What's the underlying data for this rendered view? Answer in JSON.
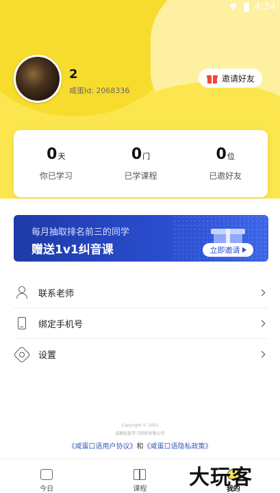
{
  "status": {
    "time": "4:34"
  },
  "profile": {
    "name": "2",
    "user_id": "咸蛋Id: 2068336",
    "invite_button": "邀请好友"
  },
  "stats": [
    {
      "value": "0",
      "unit": "天",
      "label": "你已学习"
    },
    {
      "value": "0",
      "unit": "门",
      "label": "已学课程"
    },
    {
      "value": "0",
      "unit": "位",
      "label": "已邀好友"
    }
  ],
  "banner": {
    "line1": "每月抽取排名前三的同学",
    "line2": "赠送1v1纠音课",
    "button": "立即邀请"
  },
  "menu": [
    {
      "label": "联系老师",
      "icon": "teacher-icon"
    },
    {
      "label": "绑定手机号",
      "icon": "phone-icon"
    },
    {
      "label": "设置",
      "icon": "settings-icon"
    }
  ],
  "footer": {
    "copyright_line1": "Copyright © 2021",
    "copyright_line2": "成都起智学习科技有限公司",
    "agreement": "《咸蛋口语用户协议》",
    "and": "和",
    "privacy": "《咸蛋口语隐私政策》"
  },
  "nav": [
    {
      "label": "今日",
      "icon": "calendar-icon",
      "active": false
    },
    {
      "label": "课程",
      "icon": "book-icon",
      "active": false
    },
    {
      "label": "我的",
      "icon": "profile-icon",
      "active": true
    }
  ],
  "watermark": "大玩客",
  "colors": {
    "brand_yellow": "#fbe64f",
    "banner_blue": "#2a4ed0",
    "link_blue": "#3a5ab8"
  }
}
